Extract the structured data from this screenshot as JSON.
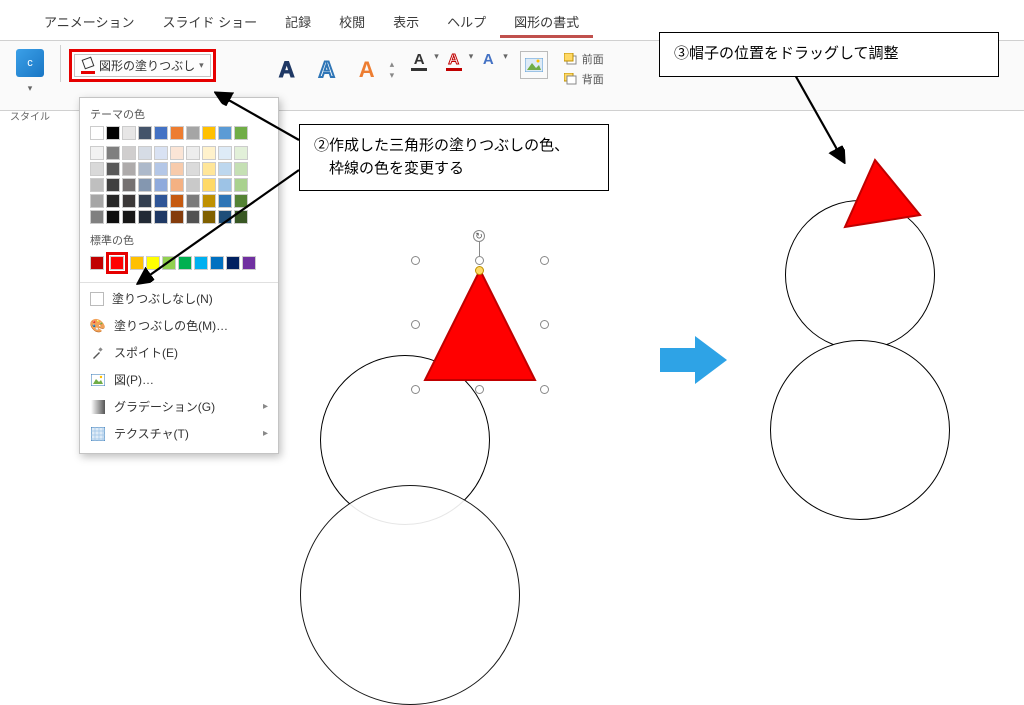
{
  "ribbon": {
    "tabs": [
      "アニメーション",
      "スライド ショー",
      "記録",
      "校閲",
      "表示",
      "ヘルプ",
      "図形の書式"
    ],
    "active_index": 6
  },
  "toolbar": {
    "fill_button_label": "図形の塗りつぶし",
    "styles_label": "スタイル",
    "arrange_front": "前面",
    "arrange_back": "背面"
  },
  "dropdown": {
    "theme_title": "テーマの色",
    "standard_title": "標準の色",
    "theme_colors_row1": [
      "#ffffff",
      "#000000",
      "#e7e6e6",
      "#44546a",
      "#4472c4",
      "#ed7d31",
      "#a5a5a5",
      "#ffc000",
      "#5b9bd5",
      "#70ad47"
    ],
    "theme_shades": [
      [
        "#f2f2f2",
        "#7f7f7f",
        "#d0cece",
        "#d6dce5",
        "#d9e2f3",
        "#fbe5d6",
        "#ededed",
        "#fff2cc",
        "#deebf7",
        "#e2f0d9"
      ],
      [
        "#d9d9d9",
        "#595959",
        "#aeabab",
        "#adb9ca",
        "#b4c7e7",
        "#f7cbac",
        "#dbdbdb",
        "#ffe699",
        "#bdd7ee",
        "#c5e0b4"
      ],
      [
        "#bfbfbf",
        "#404040",
        "#757171",
        "#8497b0",
        "#8faadc",
        "#f4b183",
        "#c9c9c9",
        "#ffd966",
        "#9dc3e6",
        "#a9d18e"
      ],
      [
        "#a6a6a6",
        "#262626",
        "#3b3838",
        "#333f50",
        "#2f5597",
        "#c55a11",
        "#7b7b7b",
        "#bf9000",
        "#2e75b6",
        "#548235"
      ],
      [
        "#808080",
        "#0d0d0d",
        "#171717",
        "#222a35",
        "#1f3864",
        "#843c0c",
        "#525252",
        "#806000",
        "#1e4e79",
        "#385723"
      ]
    ],
    "standard_colors": [
      "#c00000",
      "#ff0000",
      "#ffc000",
      "#ffff00",
      "#92d050",
      "#00b050",
      "#00b0f0",
      "#0070c0",
      "#002060",
      "#7030a0"
    ],
    "no_fill": "塗りつぶしなし(N)",
    "more_colors": "塗りつぶしの色(M)…",
    "eyedropper": "スポイト(E)",
    "picture": "図(P)…",
    "gradient": "グラデーション(G)",
    "texture": "テクスチャ(T)"
  },
  "callouts": {
    "c2_line1": "②作成した三角形の塗りつぶしの色、",
    "c2_line2": "　枠線の色を変更する",
    "c3": "③帽子の位置をドラッグして調整"
  },
  "shapes": {
    "triangle_fill": "#ff0000",
    "triangle_stroke": "#c00000"
  }
}
